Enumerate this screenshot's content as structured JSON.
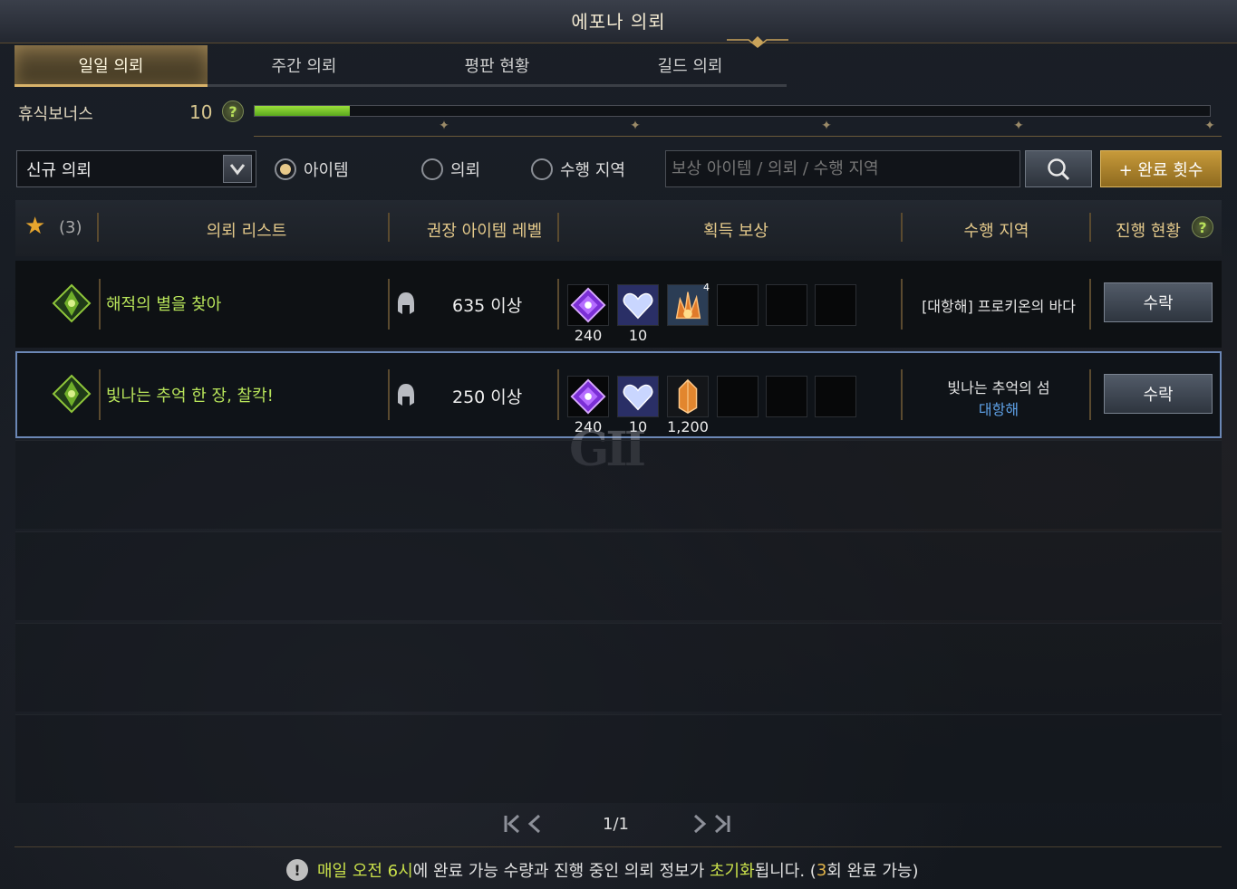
{
  "window": {
    "title": "에포나 의뢰"
  },
  "tabs": [
    {
      "label": "일일 의뢰",
      "active": true
    },
    {
      "label": "주간 의뢰",
      "active": false
    },
    {
      "label": "평판 현황",
      "active": false
    },
    {
      "label": "길드 의뢰",
      "active": false
    }
  ],
  "rest_bonus": {
    "label": "휴식보너스",
    "value": "10",
    "help": "?",
    "progress": 0.1
  },
  "filter": {
    "dropdown_value": "신규 의뢰",
    "radios": [
      {
        "label": "아이템",
        "selected": true
      },
      {
        "label": "의뢰",
        "selected": false
      },
      {
        "label": "수행 지역",
        "selected": false
      }
    ],
    "search_placeholder": "보상 아이템 / 의뢰 / 수행 지역",
    "complete_button": "+ 완료 횟수"
  },
  "list_header": {
    "favorites_count": "(3)",
    "col_list": "의뢰 리스트",
    "col_level": "권장 아이템 레벨",
    "col_reward": "획득 보상",
    "col_region": "수행 지역",
    "col_progress": "진행 현황",
    "help": "?"
  },
  "quests": [
    {
      "name": "해적의 별을 찾아",
      "level": "635 이상",
      "rewards": [
        {
          "icon": "purple-gem-icon",
          "count": "240"
        },
        {
          "icon": "blue-heart-gem-icon",
          "count": "10"
        },
        {
          "icon": "orange-crystal-cluster-icon",
          "count": "",
          "badge": "4"
        }
      ],
      "region": "[대항해] 프로키온의 바다",
      "region_sub": "",
      "accept": "수락"
    },
    {
      "name": "빛나는 추억 한 장, 찰칵!",
      "level": "250 이상",
      "rewards": [
        {
          "icon": "purple-gem-icon",
          "count": "240"
        },
        {
          "icon": "blue-heart-gem-icon",
          "count": "10"
        },
        {
          "icon": "orange-crystal-icon",
          "count": "1,200"
        }
      ],
      "region": "빛나는 추억의 섬",
      "region_sub": "대항해",
      "accept": "수락"
    }
  ],
  "pagination": {
    "first": "K",
    "prev": "<",
    "page": "1/1",
    "next": ">",
    "last": "K"
  },
  "notice": {
    "icon": "!",
    "hl1": "매일 오전 6시",
    "text1": "에 완료 가능 수량과 진행 중인 의뢰 정보가 ",
    "hl2": "초기화",
    "text2": "됩니다. (",
    "hl3": "3",
    "text3": "회 완료 가능)"
  },
  "watermark": "GII",
  "colors": {
    "accent_green": "#b7e35a",
    "gold": "#d9b36a",
    "selected_border": "#6b87b5"
  }
}
